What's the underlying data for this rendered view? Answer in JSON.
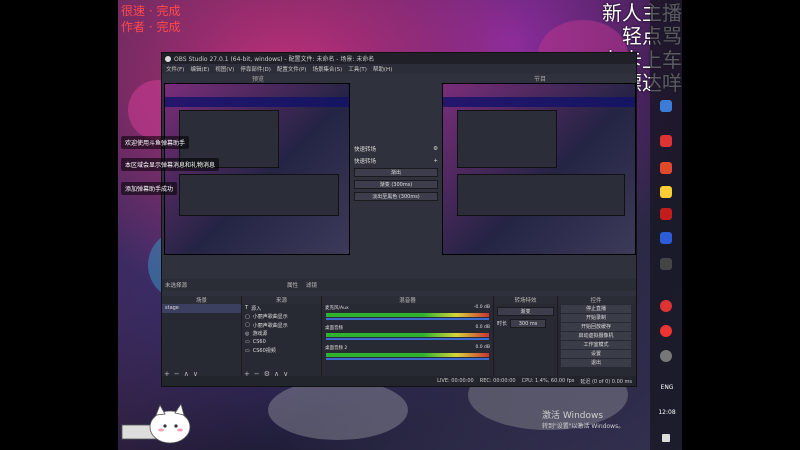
{
  "overlay": {
    "red_line1": "很速 · 完成",
    "red_line2": "作者 · 完成",
    "big_lines": [
      "新人主播",
      "轻点骂",
      "-办卡上车",
      "白嫖达咩"
    ]
  },
  "obs": {
    "window_title": "OBS Studio 27.0.1 (64-bit, windows) - 配置文件: 未命名 - 场景: 未命名",
    "menu": [
      "文件(F)",
      "编辑(E)",
      "视图(V)",
      "停靠部件(D)",
      "配置文件(P)",
      "场景集合(S)",
      "工具(T)",
      "帮助(H)"
    ],
    "preview_label": "预览",
    "program_label": "节目",
    "transition": {
      "quick_label": "快速转场",
      "add_label": "快速转场",
      "items": [
        "渐出",
        "渐变 (300ms)",
        "淡出至黑色 (300ms)"
      ]
    },
    "scene_bar_text": "未选择源",
    "scene_bar_buttons": [
      "属性",
      "滤镜"
    ],
    "docks": {
      "scenes_header": "场景",
      "scenes": [
        "stage"
      ],
      "sources_header": "来源",
      "sources": [
        "源入",
        "小丽声歌曲显示",
        "小丽声歌曲显示",
        "游戏源",
        "CS60",
        "CS60视频"
      ],
      "mixer_header": "混音器",
      "mixer_channels": [
        {
          "name": "麦克风/Aux",
          "db": "-0.0 dB"
        },
        {
          "name": "桌面音频",
          "db": "0.0 dB"
        },
        {
          "name": "桌面音频 2",
          "db": "0.0 dB"
        }
      ],
      "transitions_header": "转场特效",
      "transition_value": "渐变",
      "duration_label": "时长",
      "duration_value": "300 ms",
      "controls_header": "控件",
      "controls": [
        "停止直播",
        "开始录制",
        "开始回放缓存",
        "启动虚拟摄像机",
        "工作室模式",
        "设置",
        "退出"
      ]
    },
    "status": [
      "LIVE: 00:00:00",
      "REC: 00:00:00",
      "CPU: 1.4%, 60.00 fps",
      "延迟 (0 of 0) 0.00 ms"
    ]
  },
  "chat": [
    "欢迎使用斗鱼弹幕助手",
    "本区域会显示弹幕消息和礼物消息",
    "添加弹幕助手成功"
  ],
  "taskbar": {
    "lang": "ENG",
    "time": "12:08"
  },
  "activate": {
    "title": "激活 Windows",
    "subtitle": "转到\"设置\"以激活 Windows。"
  },
  "colors": {
    "obs_bg": "#272a33",
    "overlay_red": "#ff4a4a",
    "accent_pink": "#c6307f"
  }
}
